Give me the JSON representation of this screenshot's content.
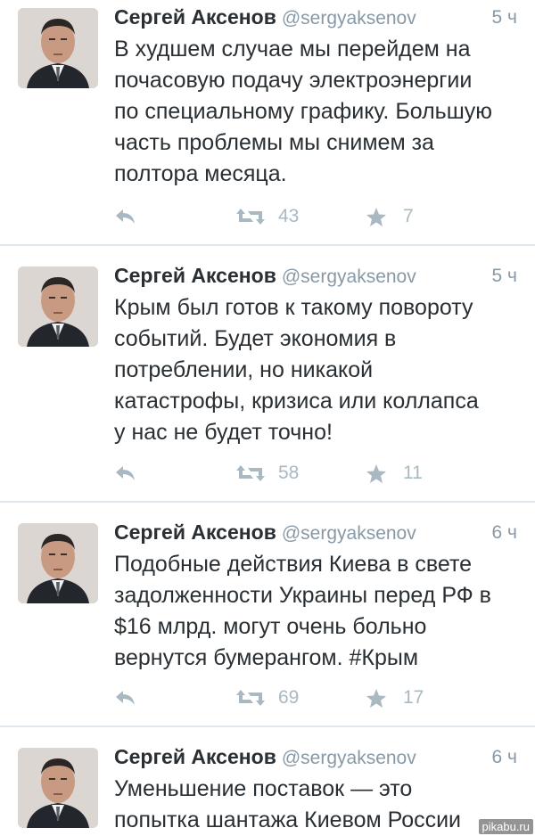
{
  "tweets": [
    {
      "name": "Сергей Аксенов",
      "handle": "@sergyaksenov",
      "time": "5 ч",
      "lines": [
        "В худшем случае мы перейдем на",
        "почасовую подачу электроэнергии",
        "по специальному графику. Большую",
        "часть проблемы мы снимем за",
        "полтора месяца."
      ],
      "retweets": "43",
      "favorites": "7"
    },
    {
      "name": "Сергей Аксенов",
      "handle": "@sergyaksenov",
      "time": "5 ч",
      "lines": [
        "Крым был готов к такому повороту",
        "событий. Будет экономия в",
        "потреблении, но никакой",
        "катастрофы, кризиса или коллапса",
        "у нас не будет точно!"
      ],
      "retweets": "58",
      "favorites": "11"
    },
    {
      "name": "Сергей Аксенов",
      "handle": "@sergyaksenov",
      "time": "6 ч",
      "lines": [
        "Подобные действия Киева в свете",
        "задолженности Украины перед РФ в",
        "$16 млрд. могут очень больно",
        "вернутся бумерангом. #Крым"
      ],
      "retweets": "69",
      "favorites": "17"
    },
    {
      "name": "Сергей Аксенов",
      "handle": "@sergyaksenov",
      "time": "6 ч",
      "lines": [
        "Уменьшение поставок — это",
        "попытка шантажа Киевом России"
      ],
      "retweets": "",
      "favorites": ""
    }
  ],
  "watermark": "pikabu.ru",
  "colors": {
    "text": "#292f33",
    "muted": "#8899a6",
    "icon": "#aab8c2",
    "divider": "#e1e8ed"
  },
  "icons": [
    "reply-icon",
    "retweet-icon",
    "star-icon"
  ]
}
